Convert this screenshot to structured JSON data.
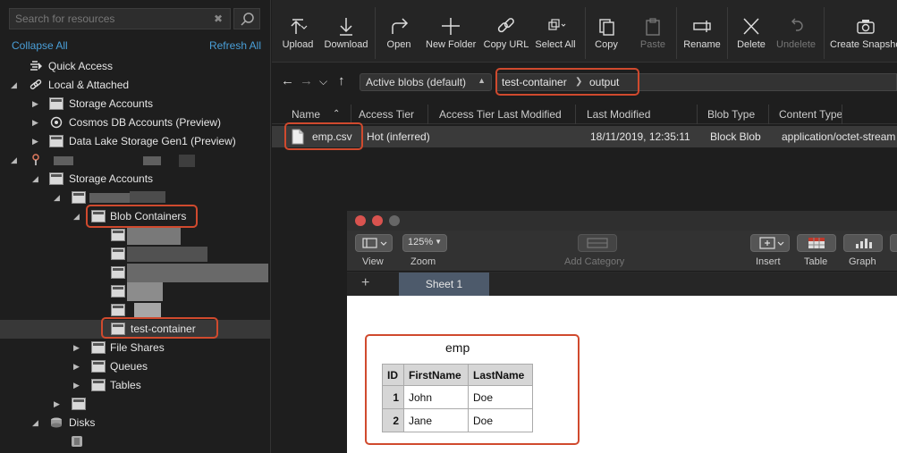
{
  "left_panel": {
    "search_placeholder": "Search for resources",
    "collapse_all": "Collapse All",
    "refresh_all": "Refresh All",
    "tree": {
      "quick_access": "Quick Access",
      "local_attached": "Local & Attached",
      "storage_accounts_local": "Storage Accounts",
      "cosmos_db": "Cosmos DB Accounts (Preview)",
      "data_lake": "Data Lake Storage Gen1 (Preview)",
      "storage_accounts": "Storage Accounts",
      "blob_containers": "Blob Containers",
      "test_container": "test-container",
      "file_shares": "File Shares",
      "queues": "Queues",
      "tables": "Tables",
      "disks": "Disks"
    }
  },
  "toolbar": {
    "upload": "Upload",
    "download": "Download",
    "open": "Open",
    "new_folder": "New Folder",
    "copy_url": "Copy URL",
    "select_all": "Select All",
    "copy": "Copy",
    "paste": "Paste",
    "rename": "Rename",
    "delete": "Delete",
    "undelete": "Undelete",
    "create_snapshot": "Create Snapshot"
  },
  "address_bar": {
    "view_option": "Active blobs (default)",
    "path": [
      "test-container",
      "output"
    ]
  },
  "file_table": {
    "columns": [
      "Name",
      "Access Tier",
      "Access Tier Last Modified",
      "Last Modified",
      "Blob Type",
      "Content Type"
    ],
    "rows": [
      {
        "name": "emp.csv",
        "access_tier": "Hot (inferred)",
        "tier_modified": "",
        "last_modified": "18/11/2019, 12:35:11",
        "blob_type": "Block Blob",
        "content_type": "application/octet-stream"
      }
    ]
  },
  "numbers_window": {
    "toolbar": {
      "view": "View",
      "zoom": "Zoom",
      "zoom_value": "125%",
      "add_category": "Add Category",
      "insert": "Insert",
      "table": "Table",
      "graph": "Graph"
    },
    "add_sheet": "+",
    "sheet_tab": "Sheet 1",
    "table_title": "emp",
    "table": {
      "headers": [
        "ID",
        "FirstName",
        "LastName"
      ],
      "rows": [
        [
          "1",
          "John",
          "Doe"
        ],
        [
          "2",
          "Jane",
          "Doe"
        ]
      ]
    }
  },
  "colors": {
    "highlight": "#d04a2e",
    "link": "#4a9fd8",
    "sheet_tab": "#4d5a6b"
  }
}
